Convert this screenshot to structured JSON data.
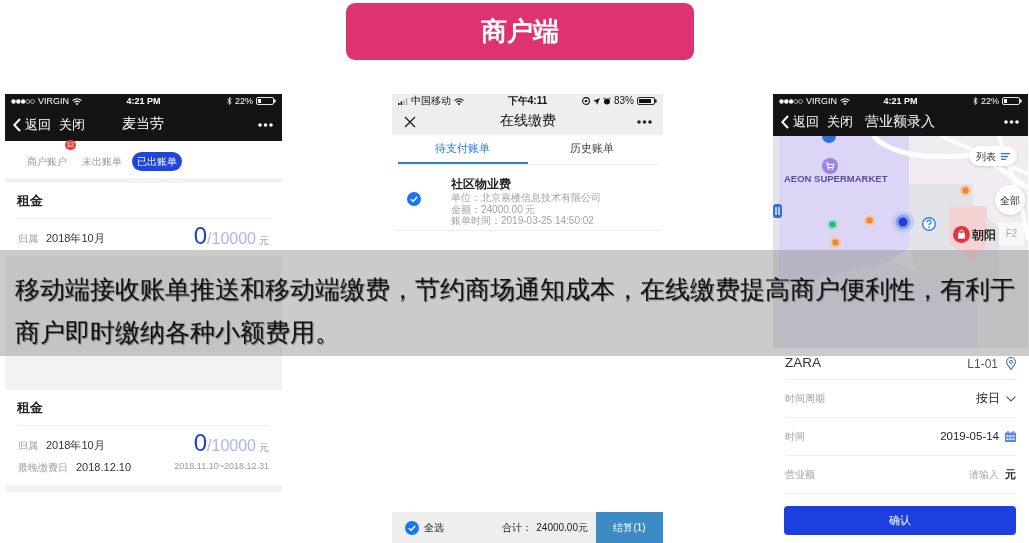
{
  "title": "商户端",
  "bill_list_screen": {
    "status_bar": {
      "carrier": "VIRGIN",
      "time": "4:21 PM",
      "battery": "22%"
    },
    "nav_bar": {
      "back": "返回",
      "close": "关闭",
      "title": "麦当劳"
    },
    "tabs": [
      {
        "label": "商户账户",
        "badge": "12",
        "selected": false
      },
      {
        "label": "未出账单",
        "selected": false
      },
      {
        "label": "已出账单",
        "selected": true
      }
    ],
    "bills": [
      {
        "title": "租金",
        "rows": [
          {
            "kind": "amount",
            "label": "归属",
            "value": "2018年10月",
            "amount": "0",
            "total": "/10000",
            "unit": "元"
          }
        ]
      },
      {
        "title": "租金",
        "rows": [
          {
            "kind": "amount",
            "label": "归属",
            "value": "2018年10月",
            "amount": "0",
            "total": "/10000",
            "unit": "元"
          },
          {
            "kind": "deadline",
            "label": "最晚缴费日",
            "value": "2018.12.10",
            "period": "2018.11.10~2018.12.31"
          }
        ]
      }
    ]
  },
  "payment_screen": {
    "status_bar": {
      "carrier": "中国移动",
      "time": "下午4:11",
      "battery": "83%"
    },
    "nav_bar": {
      "title": "在线缴费"
    },
    "tabs": [
      {
        "label": "待支付账单",
        "selected": true
      },
      {
        "label": "历史账单",
        "selected": false
      }
    ],
    "bills": [
      {
        "title": "社区物业费",
        "checked": true,
        "lines": [
          "单位：北京嘉楼信息技术有限公司",
          "金额：24000.00 元",
          "账单时间：2019-03-25 14:50:02"
        ]
      }
    ],
    "footer": {
      "select_all": "全选",
      "checked": true,
      "total_label": "合计：",
      "total": "24000.00元",
      "checkout": "结算(1)"
    }
  },
  "revenue_screen": {
    "status_bar": {
      "carrier": "VIRGIN",
      "time": "4:21 PM",
      "battery": "22%"
    },
    "nav_bar": {
      "back": "返回",
      "close": "关闭",
      "title": "营业额录入"
    },
    "map": {
      "list_button": "列表",
      "store_label": "AEON SUPERMARKET",
      "all_button": "全部",
      "place_label": "朝阳",
      "floor": "F2"
    },
    "store": {
      "name": "ZARA",
      "unit": "L1-01"
    },
    "fields": [
      {
        "kind": "select",
        "label": "时间周期",
        "value": "按日"
      },
      {
        "kind": "date",
        "label": "时间",
        "value": "2019-05-14"
      },
      {
        "kind": "input",
        "label": "营业额",
        "placeholder": "请输入",
        "unit": "元"
      }
    ],
    "confirm": "确认"
  },
  "caption": "移动端接收账单推送和移动端缴费，节约商场通知成本，在线缴费提高商户便利性，有利于商户即时缴纳各种小额费用。"
}
